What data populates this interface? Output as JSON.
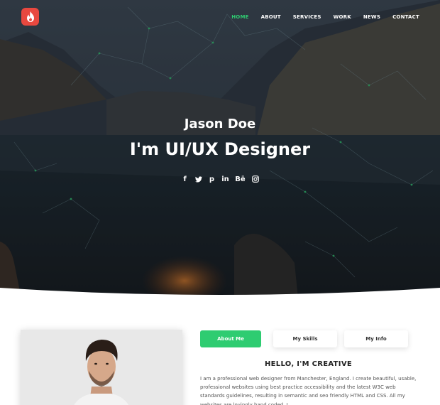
{
  "header": {
    "logo_icon": "flame-icon",
    "nav": [
      {
        "label": "HOME",
        "active": true
      },
      {
        "label": "ABOUT",
        "active": false
      },
      {
        "label": "SERVICES",
        "active": false
      },
      {
        "label": "WORK",
        "active": false
      },
      {
        "label": "NEWS",
        "active": false
      },
      {
        "label": "CONTACT",
        "active": false
      }
    ]
  },
  "hero": {
    "name": "Jason Doe",
    "title": "I'm UI/UX Designer",
    "social": [
      {
        "icon": "facebook-icon",
        "glyph": "f"
      },
      {
        "icon": "twitter-icon",
        "glyph": "🐦"
      },
      {
        "icon": "pinterest-icon",
        "glyph": "p"
      },
      {
        "icon": "linkedin-icon",
        "glyph": "in"
      },
      {
        "icon": "behance-icon",
        "glyph": "Bē"
      },
      {
        "icon": "instagram-icon",
        "glyph": "◎"
      }
    ]
  },
  "about": {
    "tabs": [
      {
        "label": "About Me",
        "active": true
      },
      {
        "label": "My Skills",
        "active": false
      },
      {
        "label": "My Info",
        "active": false
      }
    ],
    "heading": "HELLO, I'M CREATIVE",
    "text": "I am a professional web designer from Manchester, England. I create beautiful, usable, professional websites using best practice accessibility and the latest W3C web standards guidelines, resulting in semantic and seo friendly HTML and CSS. All my websites are lovingly hand coded. I"
  },
  "colors": {
    "accent": "#2ecc71",
    "logo": "#e8483f"
  }
}
